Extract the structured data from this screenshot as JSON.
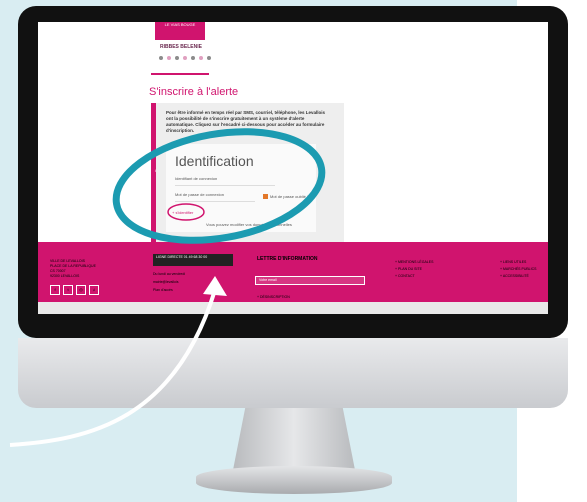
{
  "page": {
    "top_banner_text": "LE VIAS BOUGE",
    "top_link": "RIBBES BELENIE",
    "section_title": "S'inscrire à l'alerte",
    "info_text": "Pour être informé en temps réel par SMS, courriel, téléphone, les Levallois ont la possibilité de s'inscrire gratuitement à un système d'alerte automatique. Cliquez sur l'encadré ci-dessous pour accéder au formulaire d'inscription.",
    "card_marker": "i",
    "identification": {
      "title": "Identification",
      "login_label": "Identifiant de connexion",
      "password_label": "Mot de passe de connexion",
      "forgot_password": "Mot de passe oublié ?",
      "login_button": "+ s'identifier",
      "modify_link": "Vous pouvez modifier vos données personnelles"
    }
  },
  "footer": {
    "address_lines": [
      "VILLE DE LEVALLOIS",
      "PLACE DE LA REPUBLIQUE",
      "CS 70007",
      "92300 LEVALLOIS"
    ],
    "social": [
      "f",
      "t",
      "◎",
      "♫"
    ],
    "contact_box": "LIGNE DIRECTE 01 49 68 30 00",
    "contact_lines": [
      "Du lundi au vendredi",
      "mairie@levallois",
      "Plan d'accès"
    ],
    "newsletter_title": "LETTRE D'INFORMATION",
    "newsletter_placeholder": "Votre email",
    "newsletter_link": "+ DÉSINSCRIPTION",
    "col3_links": [
      "+ MENTIONS LÉGALES",
      "+ PLAN DU SITE",
      "+ CONTACT"
    ],
    "col4_links": [
      "+ LIENS UTILES",
      "+ MARCHÉS PUBLICS",
      "+ ACCESSIBILITÉ"
    ]
  },
  "colors": {
    "brand": "#d0146e",
    "annotation_ring": "#1c9bb1",
    "background_panel": "#d9edf2"
  }
}
